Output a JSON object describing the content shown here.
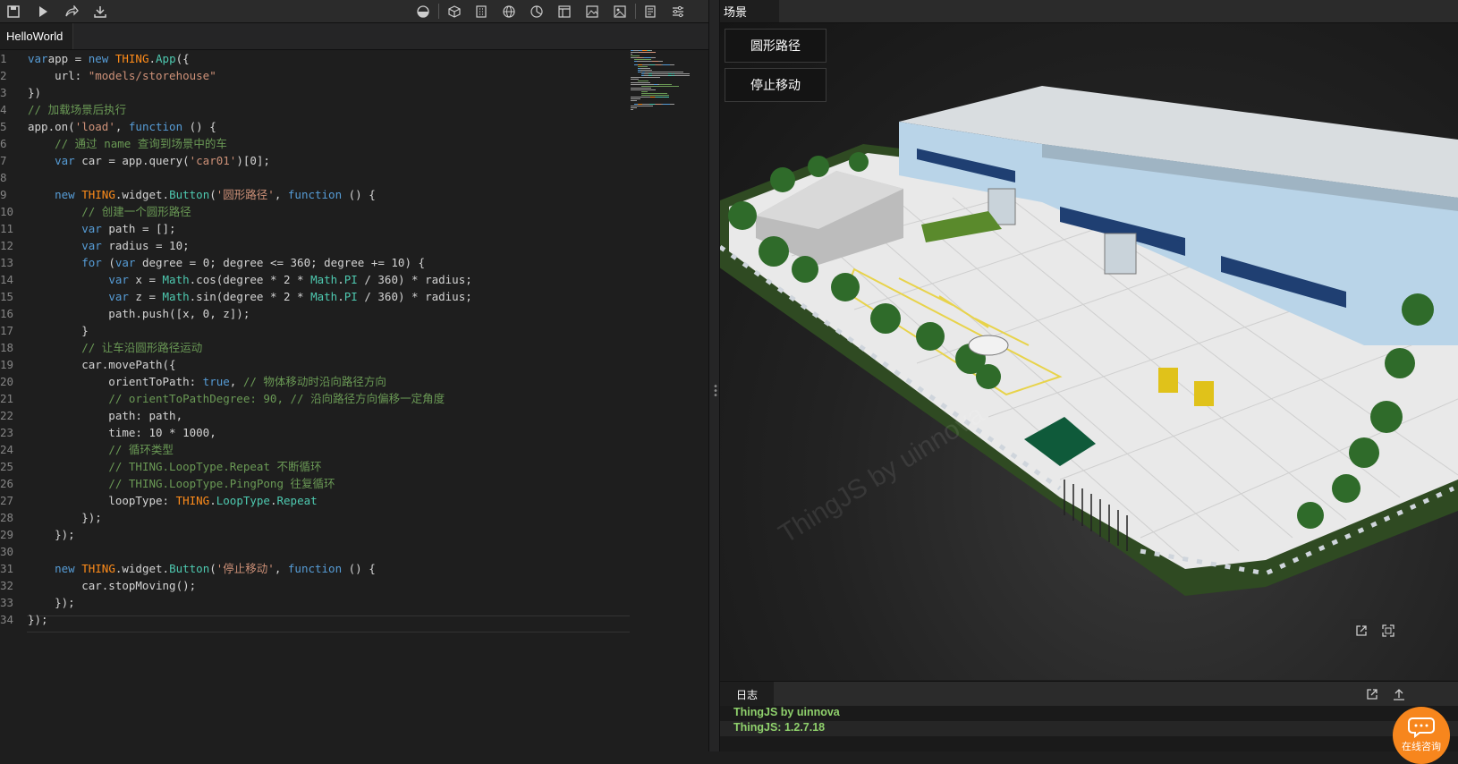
{
  "toolbar": {
    "icons": [
      "save-icon",
      "run-icon",
      "share-icon",
      "download-icon",
      "theme-icon",
      "cube-icon",
      "building-icon",
      "globe-icon",
      "chart-icon",
      "layout-icon",
      "image-icon",
      "photo-icon",
      "notes-icon",
      "settings-icon"
    ]
  },
  "file_tab": {
    "label": "HelloWorld"
  },
  "code": {
    "line_numbers": [
      "1",
      "2",
      "3",
      "4",
      "5",
      "6",
      "7",
      "8",
      "9",
      "10",
      "11",
      "12",
      "13",
      "14",
      "15",
      "16",
      "17",
      "18",
      "19",
      "20",
      "21",
      "22",
      "23",
      "24",
      "25",
      "26",
      "27",
      "28",
      "29",
      "30",
      "31",
      "32",
      "33",
      "34"
    ],
    "lines": [
      [
        [
          "kw",
          "var"
        ],
        [
          "",
          "app = "
        ],
        [
          "kw",
          "new "
        ],
        [
          "th",
          "THING"
        ],
        [
          "",
          "."
        ],
        [
          "cls",
          "App"
        ],
        [
          "",
          "({"
        ]
      ],
      [
        [
          "",
          "    url: "
        ],
        [
          "str",
          "\"models/storehouse\""
        ]
      ],
      [
        [
          "",
          "})"
        ]
      ],
      [
        [
          "cm",
          "// 加载场景后执行"
        ]
      ],
      [
        [
          "",
          "app.on("
        ],
        [
          "str",
          "'load'"
        ],
        [
          "",
          ", "
        ],
        [
          "kw",
          "function"
        ],
        [
          "",
          " () {"
        ]
      ],
      [
        [
          "",
          "    "
        ],
        [
          "cm",
          "// 通过 name 查询到场景中的车"
        ]
      ],
      [
        [
          "",
          "    "
        ],
        [
          "kw",
          "var"
        ],
        [
          "",
          " car = app.query("
        ],
        [
          "str",
          "'car01'"
        ],
        [
          "",
          ")[0];"
        ]
      ],
      [
        [
          "",
          ""
        ]
      ],
      [
        [
          "",
          "    "
        ],
        [
          "kw",
          "new "
        ],
        [
          "th",
          "THING"
        ],
        [
          "",
          ".widget."
        ],
        [
          "cls",
          "Button"
        ],
        [
          "",
          "("
        ],
        [
          "str",
          "'圆形路径'"
        ],
        [
          "",
          ", "
        ],
        [
          "kw",
          "function"
        ],
        [
          "",
          " () {"
        ]
      ],
      [
        [
          "",
          "        "
        ],
        [
          "cm",
          "// 创建一个圆形路径"
        ]
      ],
      [
        [
          "",
          "        "
        ],
        [
          "kw",
          "var"
        ],
        [
          "",
          " path = [];"
        ]
      ],
      [
        [
          "",
          "        "
        ],
        [
          "kw",
          "var"
        ],
        [
          "",
          " radius = 10;"
        ]
      ],
      [
        [
          "",
          "        "
        ],
        [
          "kw",
          "for"
        ],
        [
          "",
          " ("
        ],
        [
          "kw",
          "var"
        ],
        [
          "",
          " degree = 0; degree <= 360; degree += 10) {"
        ]
      ],
      [
        [
          "",
          "            "
        ],
        [
          "kw",
          "var"
        ],
        [
          "",
          " x = "
        ],
        [
          "cls",
          "Math"
        ],
        [
          "",
          ".cos(degree * 2 * "
        ],
        [
          "cls",
          "Math"
        ],
        [
          "",
          "."
        ],
        [
          "cls",
          "PI"
        ],
        [
          "",
          " / 360) * radius;"
        ]
      ],
      [
        [
          "",
          "            "
        ],
        [
          "kw",
          "var"
        ],
        [
          "",
          " z = "
        ],
        [
          "cls",
          "Math"
        ],
        [
          "",
          ".sin(degree * 2 * "
        ],
        [
          "cls",
          "Math"
        ],
        [
          "",
          "."
        ],
        [
          "cls",
          "PI"
        ],
        [
          "",
          " / 360) * radius;"
        ]
      ],
      [
        [
          "",
          "            path.push([x, 0, z]);"
        ]
      ],
      [
        [
          "",
          "        }"
        ]
      ],
      [
        [
          "",
          "        "
        ],
        [
          "cm",
          "// 让车沿圆形路径运动"
        ]
      ],
      [
        [
          "",
          "        car.movePath({"
        ]
      ],
      [
        [
          "",
          "            orientToPath: "
        ],
        [
          "kw",
          "true"
        ],
        [
          "",
          ", "
        ],
        [
          "cm",
          "// 物体移动时沿向路径方向"
        ]
      ],
      [
        [
          "",
          "            "
        ],
        [
          "cm",
          "// orientToPathDegree: 90, // 沿向路径方向偏移一定角度"
        ]
      ],
      [
        [
          "",
          "            path: path,"
        ]
      ],
      [
        [
          "",
          "            time: 10 * 1000,"
        ]
      ],
      [
        [
          "",
          "            "
        ],
        [
          "cm",
          "// 循环类型"
        ]
      ],
      [
        [
          "",
          "            "
        ],
        [
          "cm",
          "// THING.LoopType.Repeat 不断循环"
        ]
      ],
      [
        [
          "",
          "            "
        ],
        [
          "cm",
          "// THING.LoopType.PingPong 往复循环"
        ]
      ],
      [
        [
          "",
          "            loopType: "
        ],
        [
          "th",
          "THING"
        ],
        [
          "",
          "."
        ],
        [
          "cls",
          "LoopType"
        ],
        [
          "",
          "."
        ],
        [
          "cls",
          "Repeat"
        ]
      ],
      [
        [
          "",
          "        });"
        ]
      ],
      [
        [
          "",
          "    });"
        ]
      ],
      [
        [
          "",
          ""
        ]
      ],
      [
        [
          "",
          "    "
        ],
        [
          "kw",
          "new "
        ],
        [
          "th",
          "THING"
        ],
        [
          "",
          ".widget."
        ],
        [
          "cls",
          "Button"
        ],
        [
          "",
          "("
        ],
        [
          "str",
          "'停止移动'"
        ],
        [
          "",
          ", "
        ],
        [
          "kw",
          "function"
        ],
        [
          "",
          " () {"
        ]
      ],
      [
        [
          "",
          "        car.stopMoving();"
        ]
      ],
      [
        [
          "",
          "    });"
        ]
      ],
      [
        [
          "",
          "});"
        ]
      ]
    ]
  },
  "scene": {
    "tab_label": "场景",
    "buttons": [
      "圆形路径",
      "停止移动"
    ],
    "watermark": "ThingJS by uinnova"
  },
  "log": {
    "tab_label": "日志",
    "lines": [
      "ThingJS by uinnova",
      "ThingJS: 1.2.7.18"
    ]
  },
  "consult": {
    "label": "在线咨询"
  },
  "colors": {
    "accent": "#f7861d",
    "log_text": "#8fd16c"
  }
}
